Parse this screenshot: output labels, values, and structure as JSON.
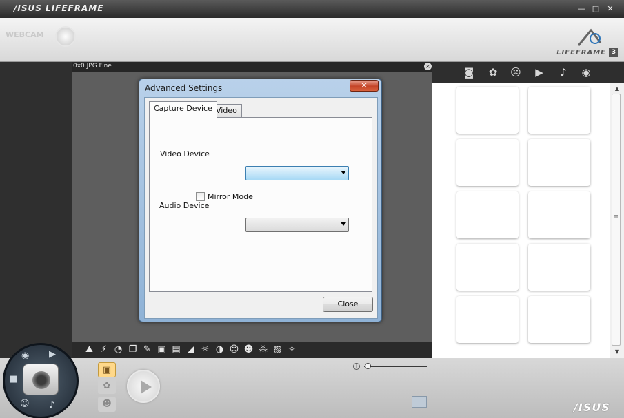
{
  "app": {
    "title": "/ISUS LIFEFRAME",
    "window_controls": {
      "close": "✕",
      "maximize": "□",
      "minimize": "—"
    },
    "header_badge": "WEBCAM",
    "logo_text": "LIFEFRAME",
    "logo_version": "3",
    "brand": "/ISUS"
  },
  "preview": {
    "format_label": "0x0 JPG Fine",
    "close_glyph": "×"
  },
  "effects_toolbar": {
    "icons": [
      "person-scene-icon",
      "flash-icon",
      "timer-icon",
      "multi-shot-icon",
      "ruler-icon",
      "frame-1-icon",
      "frame-2-icon",
      "contrast-wedge-icon",
      "brightness-icon",
      "half-circle-icon",
      "face-frame-icon",
      "face-icon",
      "color-blend-icon",
      "photo-adjust-icon",
      "wrench-icon"
    ]
  },
  "gallery": {
    "tabs": [
      "camera-icon",
      "flower-icon",
      "face-profile-icon",
      "video-camera-icon",
      "microphone-icon",
      "eye-icon"
    ]
  },
  "bottom": {
    "modes": [
      "photo-mode-icon",
      "effects-mode-icon",
      "face-mode-icon"
    ],
    "zoom_level": 0.05
  },
  "dialog": {
    "title": "Advanced Settings",
    "close_glyph": "✕",
    "tabs": [
      "Capture Device",
      "Video"
    ],
    "active_tab": "Capture Device",
    "video_device_label": "Video Device",
    "video_device_value": "",
    "mirror_mode_label": "Mirror Mode",
    "mirror_mode_checked": false,
    "audio_device_label": "Audio Device",
    "audio_device_value": "",
    "close_button": "Close"
  }
}
